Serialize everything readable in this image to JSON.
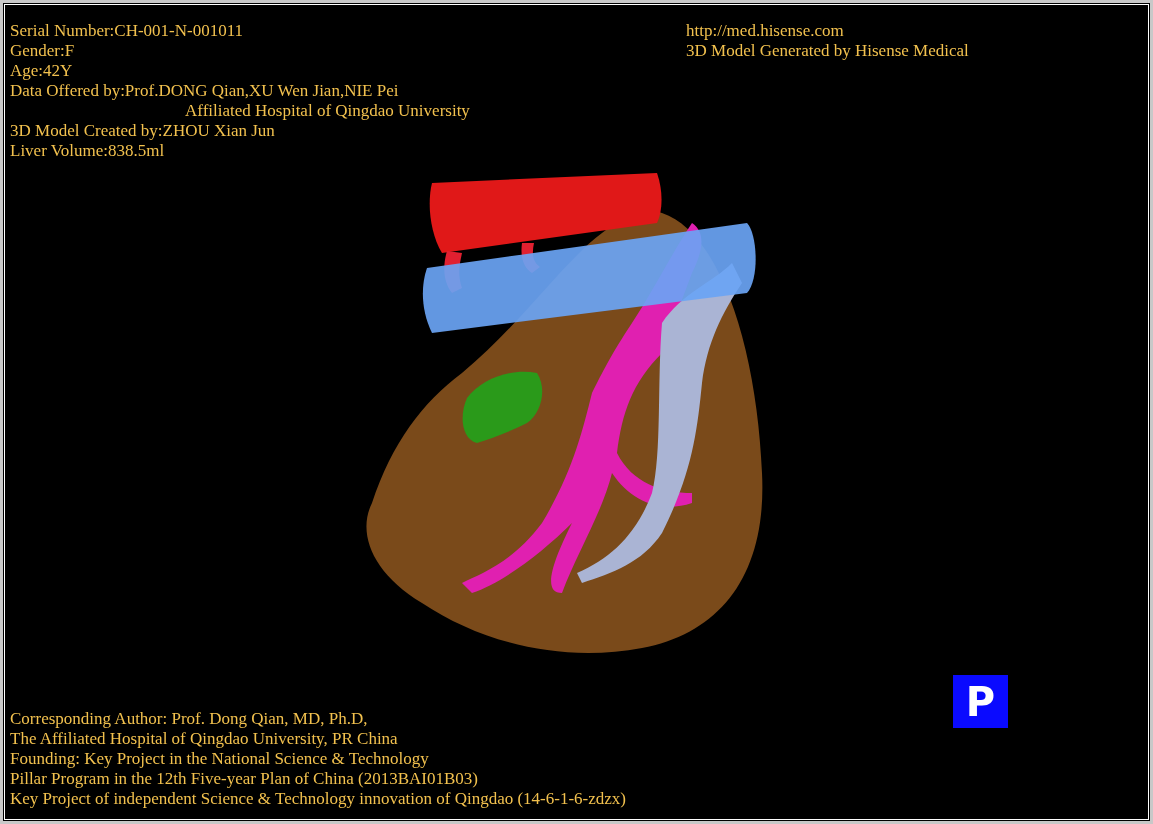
{
  "info_top_left": [
    {
      "kind": "line",
      "text": "Serial Number:CH-001-N-001011"
    },
    {
      "kind": "line",
      "text": "Gender:F"
    },
    {
      "kind": "line",
      "text": "Age:42Y"
    },
    {
      "kind": "line",
      "text": "Data Offered by:Prof.DONG Qian,XU Wen Jian,NIE Pei"
    },
    {
      "kind": "continuation",
      "text": "Affiliated Hospital of Qingdao University"
    },
    {
      "kind": "line",
      "text": "3D Model Created by:ZHOU Xian Jun"
    },
    {
      "kind": "line",
      "text": "Liver Volume:838.5ml"
    }
  ],
  "info_top_right": [
    {
      "text": "http://med.hisense.com"
    },
    {
      "text": "3D Model Generated by Hisense Medical"
    }
  ],
  "info_bottom": [
    {
      "text": "Corresponding Author: Prof. Dong Qian, MD, Ph.D,"
    },
    {
      "text": "The Affiliated Hospital of Qingdao University, PR China"
    },
    {
      "text": "Founding: Key Project in the National Science & Technology"
    },
    {
      "text": "Pillar Program in the 12th Five-year Plan of China (2013BAI01B03)"
    },
    {
      "text": "Key Project of independent Science & Technology innovation of Qingdao (14-6-1-6-zdzx)"
    }
  ],
  "view_button": {
    "label": "P"
  }
}
